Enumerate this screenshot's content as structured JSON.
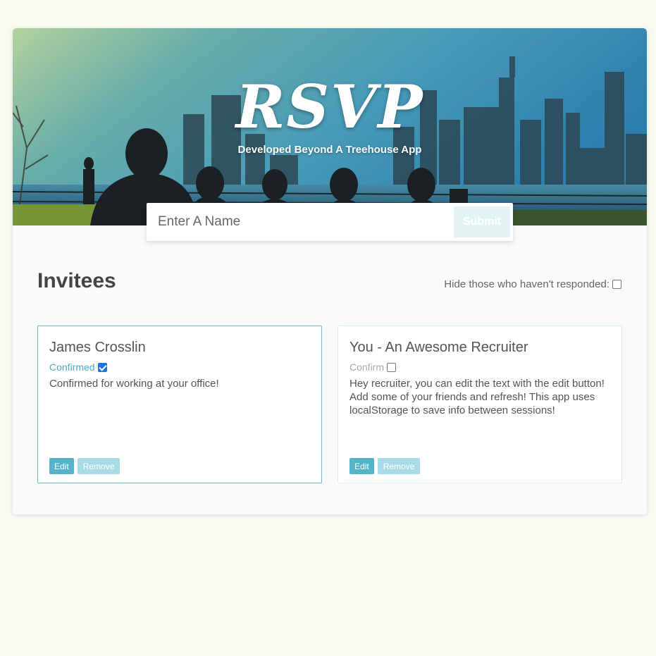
{
  "header": {
    "title": "RSVP",
    "subtitle": "Developed Beyond A Treehouse App"
  },
  "form": {
    "placeholder": "Enter A Name",
    "submit_label": "Submit"
  },
  "main": {
    "title": "Invitees",
    "filter_label": "Hide those who haven't responded:"
  },
  "invitees": [
    {
      "name": "James Crosslin",
      "status_label": "Confirmed",
      "confirmed": true,
      "note": "Confirmed for working at your office!",
      "edit_label": "Edit",
      "remove_label": "Remove"
    },
    {
      "name": "You - An Awesome Recruiter",
      "status_label": "Confirm",
      "confirmed": false,
      "note": "Hey recruiter, you can edit the text with the edit button! Add some of your friends and refresh! This app uses localStorage to save info between sessions!",
      "edit_label": "Edit",
      "remove_label": "Remove"
    }
  ],
  "colors": {
    "accent": "#53b3c9",
    "accent_light": "#a9dbe6",
    "confirmed_text": "#4aa9c4",
    "page_bg": "#f6faf0"
  }
}
